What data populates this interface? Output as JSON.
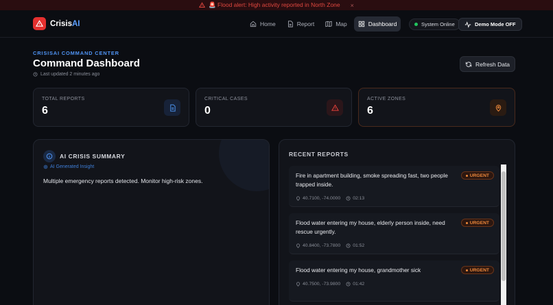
{
  "alert": {
    "text": "🚨 Flood alert: High activity reported in North Zone",
    "close": "×"
  },
  "brand": {
    "name_prefix": "Crisis",
    "name_suffix": "AI"
  },
  "nav": {
    "links": [
      {
        "label": "Home",
        "icon": "home-icon"
      },
      {
        "label": "Report",
        "icon": "report-icon"
      },
      {
        "label": "Map",
        "icon": "map-icon"
      },
      {
        "label": "Dashboard",
        "icon": "dashboard-icon",
        "active": true
      }
    ],
    "status": "System Online",
    "demo_mode": "Demo Mode OFF"
  },
  "header": {
    "eyebrow": "CRISISAI COMMAND CENTER",
    "title": "Command Dashboard",
    "updated": "Last updated 2 minutes ago",
    "refresh_label": "Refresh Data"
  },
  "stats": [
    {
      "label": "TOTAL REPORTS",
      "value": "6",
      "icon": "document-icon",
      "color": "#4a8fe8"
    },
    {
      "label": "CRITICAL CASES",
      "value": "0",
      "icon": "warning-icon",
      "color": "#e5403a"
    },
    {
      "label": "ACTIVE ZONES",
      "value": "6",
      "icon": "location-icon",
      "color": "#ef8a3b"
    }
  ],
  "summary": {
    "title": "AI CRISIS SUMMARY",
    "subtitle": "AI Generated Insight",
    "text": "Multiple emergency reports detected. Monitor high-risk zones."
  },
  "reports": {
    "title": "RECENT REPORTS",
    "items": [
      {
        "text": "Fire in apartment building, smoke spreading fast, two people trapped inside.",
        "badge": "URGENT",
        "coords": "40.7100, -74.0000",
        "time": "02:13"
      },
      {
        "text": "Flood water entering my house, elderly person inside, need rescue urgently.",
        "badge": "URGENT",
        "coords": "40.8400, -73.7800",
        "time": "01:52"
      },
      {
        "text": "Flood water entering my house, grandmother sick",
        "badge": "URGENT",
        "coords": "40.7500, -73.9800",
        "time": "01:42"
      }
    ]
  },
  "colors": {
    "accent": "#4f93f3",
    "danger": "#e5302f",
    "urgent": "#f08a3b",
    "online": "#22c55e"
  }
}
